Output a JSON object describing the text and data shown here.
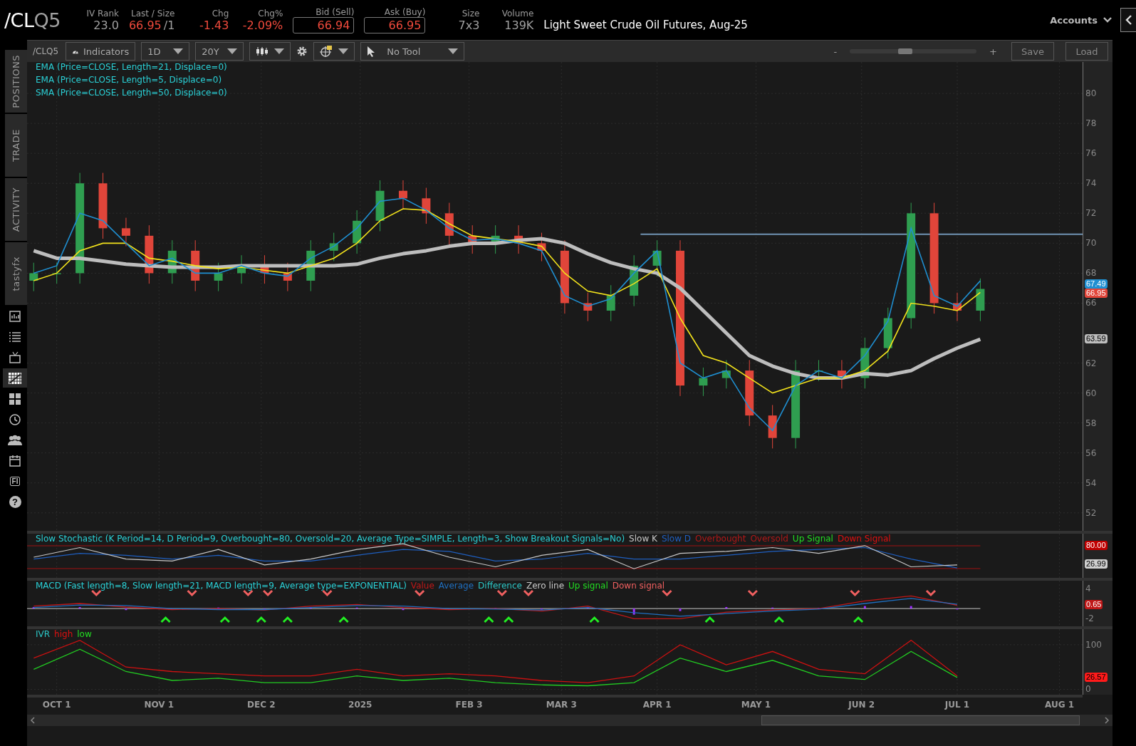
{
  "header": {
    "symbol_root": "/CL",
    "symbol_contract": "Q5",
    "quotes": [
      {
        "label": "IV Rank",
        "value": "23.0",
        "down": false,
        "boxed": false
      },
      {
        "label": "Last / Size",
        "value": "66.95",
        "down": true,
        "boxed": false,
        "suffix": "/1"
      },
      {
        "label": "Chg",
        "value": "-1.43",
        "down": true,
        "boxed": false
      },
      {
        "label": "Chg%",
        "value": "-2.09%",
        "down": true,
        "boxed": false
      },
      {
        "label": "Bid (Sell)",
        "value": "66.94",
        "down": true,
        "boxed": true
      },
      {
        "label": "Ask (Buy)",
        "value": "66.95",
        "down": true,
        "boxed": true
      },
      {
        "label": "Size",
        "value": "7x3",
        "down": false,
        "boxed": false
      },
      {
        "label": "Volume",
        "value": "139K",
        "down": false,
        "boxed": false
      }
    ],
    "description": "Light Sweet Crude Oil Futures, Aug-25",
    "accounts": "Accounts"
  },
  "toolbar": {
    "symbol": "/CLQ5",
    "indicators": "Indicators",
    "aggregation": "1D",
    "range": "20Y",
    "drawing_tool": "No Tool",
    "zoom_out": "-",
    "zoom_in": "+",
    "zoom": {
      "level": 0.44
    },
    "save": "Save",
    "load": "Load"
  },
  "sidebar": {
    "tabs": [
      {
        "label": "POSITIONS"
      },
      {
        "label": "TRADE"
      },
      {
        "label": "ACTIVITY"
      },
      {
        "label": "tastyfx"
      }
    ],
    "icons": [
      {
        "kind": "report",
        "selected": false
      },
      {
        "kind": "list",
        "selected": false
      },
      {
        "kind": "tv",
        "selected": false
      },
      {
        "kind": "chart",
        "selected": true
      },
      {
        "kind": "grid",
        "selected": false
      },
      {
        "kind": "clock",
        "selected": false
      },
      {
        "kind": "people",
        "selected": false
      },
      {
        "kind": "calendar",
        "selected": false
      },
      {
        "kind": "badge",
        "label": "FI",
        "selected": false
      },
      {
        "kind": "help",
        "label": "?",
        "selected": false
      }
    ]
  },
  "chart": {
    "main": {
      "studies": [
        "EMA (Price=CLOSE, Length=21, Displace=0)",
        "EMA (Price=CLOSE, Length=5, Displace=0)",
        "SMA (Price=CLOSE, Length=50, Displace=0)"
      ],
      "price_axis": [
        "80",
        "78",
        "76",
        "74",
        "72",
        "70",
        "68",
        "66",
        "62",
        "60",
        "58",
        "56",
        "54",
        "52"
      ],
      "badges": [
        {
          "text": "67.49",
          "color": "#1f8fd1"
        },
        {
          "text": "66.95",
          "color": "#e0453a"
        },
        {
          "text": "63.59",
          "color": "#bdbdbd"
        }
      ]
    },
    "stochastic": {
      "title": "Slow Stochastic (K Period=14, D Period=9, Overbought=80, Oversold=20, Average Type=SIMPLE, Length=3, Show Breakout Signals=No)",
      "legend": [
        {
          "label": "Slow K",
          "color": "#c8c8c8"
        },
        {
          "label": "Slow D",
          "color": "#1f5fc0"
        },
        {
          "label": "Overbought",
          "color": "#b01818"
        },
        {
          "label": "Oversold",
          "color": "#b01818"
        },
        {
          "label": "Up Signal",
          "color": "#22dd22"
        },
        {
          "label": "Down Signal",
          "color": "#e01010"
        }
      ],
      "badges": [
        {
          "text": "80.00",
          "color": "#c00000"
        },
        {
          "text": "26.99",
          "color": "#cfcfcf"
        }
      ]
    },
    "macd": {
      "title": "MACD (Fast length=8, Slow length=21, MACD length=9, Average type=EXPONENTIAL)",
      "legend": [
        {
          "label": "Value",
          "color": "#c01818"
        },
        {
          "label": "Average",
          "color": "#1f6fc0"
        },
        {
          "label": "Difference",
          "color": "#2cc6c6"
        },
        {
          "label": "Zero line",
          "color": "#c8c8c8"
        },
        {
          "label": "Up signal",
          "color": "#22dd22"
        },
        {
          "label": "Down signal",
          "color": "#f06060"
        }
      ],
      "axis": [
        "4",
        "-2"
      ],
      "badges": [
        {
          "text": "0.65",
          "color": "#c01818"
        }
      ]
    },
    "ivr": {
      "legend": [
        {
          "label": "IVR",
          "color": "#2cc6c6"
        },
        {
          "label": "high",
          "color": "#e01010"
        },
        {
          "label": "low",
          "color": "#22dd22"
        }
      ],
      "axis": [
        "100",
        "0"
      ],
      "badges": [
        {
          "text": "26.57",
          "color": "#ff1a1a"
        }
      ]
    },
    "date_axis": [
      "OCT 1",
      "NOV 1",
      "DEC 2",
      "2025",
      "FEB 3",
      "MAR 3",
      "APR 1",
      "MAY 1",
      "JUN 2",
      "JUL 1",
      "AUG 1"
    ]
  }
}
